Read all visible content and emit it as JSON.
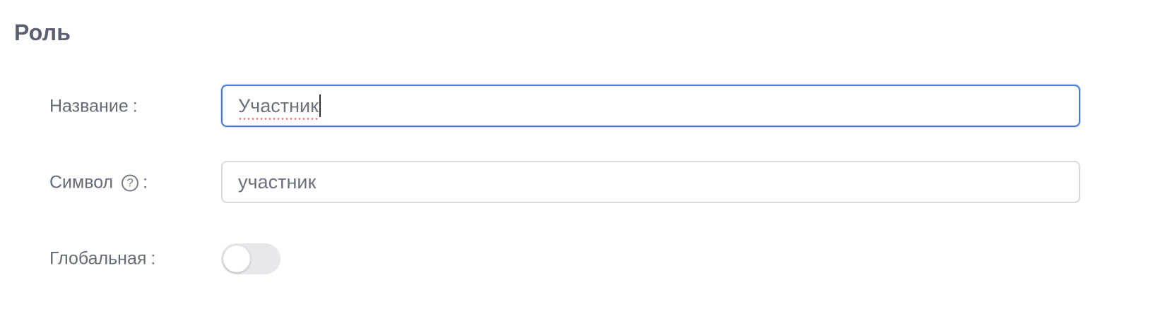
{
  "section": {
    "title": "Роль"
  },
  "form": {
    "name": {
      "label": "Название",
      "colon": ":",
      "value": "Участник",
      "focused": true
    },
    "symbol": {
      "label": "Символ",
      "help_icon": "question-circle-icon",
      "help_glyph": "?",
      "colon": ":",
      "value": "участник"
    },
    "global": {
      "label": "Глобальная",
      "colon": ":",
      "enabled": false
    }
  },
  "colors": {
    "focus_border": "#4a78d6",
    "input_border": "#d9d9d9",
    "toggle_off_bg": "#e6e8eb",
    "spellcheck_underline": "#e0545a"
  }
}
